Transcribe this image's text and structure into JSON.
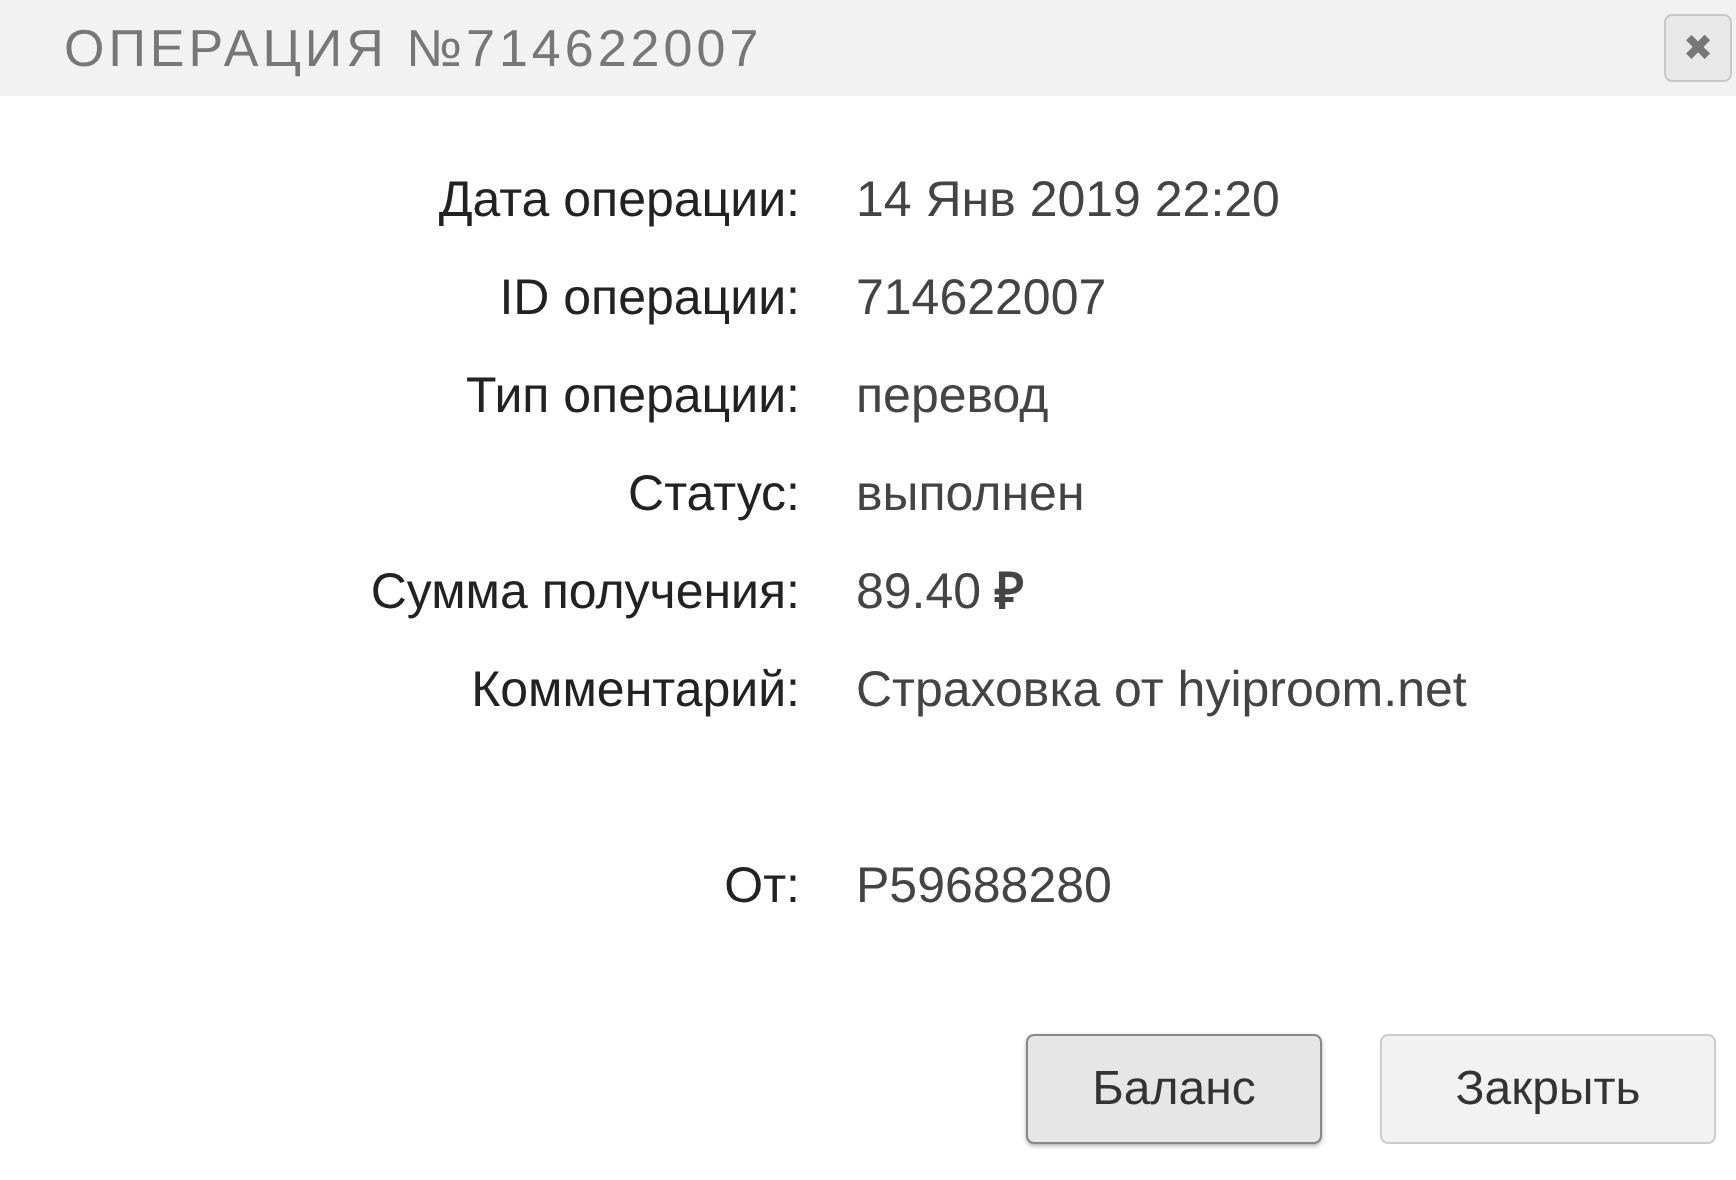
{
  "dialog": {
    "title": "ОПЕРАЦИЯ №714622007",
    "close_glyph": "✖"
  },
  "fields": [
    {
      "label": "Дата операции:",
      "value": "14 Янв 2019 22:20"
    },
    {
      "label": "ID операции:",
      "value": "714622007"
    },
    {
      "label": "Тип операции:",
      "value": "перевод"
    },
    {
      "label": "Статус:",
      "value": "выполнен"
    },
    {
      "label": "Сумма получения:",
      "value": "89.40 **₽**"
    },
    {
      "label": "Комментарий:",
      "value": "Страховка от hyiproom.net"
    }
  ],
  "sender": {
    "label": "От:",
    "value": "P59688280"
  },
  "buttons": [
    {
      "label": "Баланс",
      "focused": true
    },
    {
      "label": "Закрыть",
      "focused": false
    }
  ]
}
